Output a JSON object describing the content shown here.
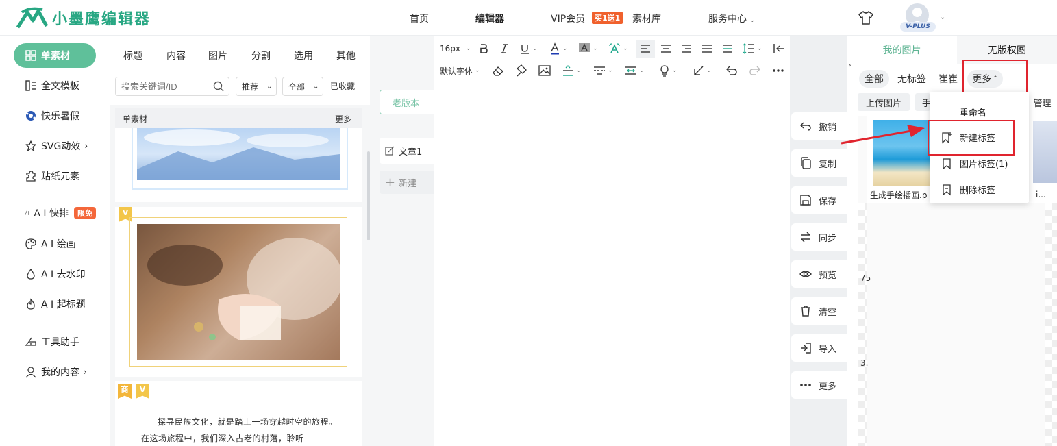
{
  "brand": {
    "name": "小墨鹰编辑器",
    "color": "#28a783"
  },
  "header": {
    "nav": {
      "home": "首页",
      "editor": "编辑器",
      "vip": "VIP会员",
      "vip_badge": "买1送1",
      "library": "素材库",
      "service": "服务中心"
    },
    "vip_plus": "V-PLUS"
  },
  "sidebar": {
    "items": [
      {
        "label": "单素材",
        "icon": "grid-icon",
        "active": true
      },
      {
        "label": "全文模板",
        "icon": "layout-icon"
      },
      {
        "label": "快乐暑假",
        "icon": "soccer-ball-icon"
      },
      {
        "label": "SVG动效",
        "icon": "star-icon",
        "has_arrow": true
      },
      {
        "label": "贴纸元素",
        "icon": "puzzle-icon"
      },
      {
        "label": "A I 快排",
        "icon": "ai-icon",
        "badge": "限免"
      },
      {
        "label": "A I 绘画",
        "icon": "palette-icon"
      },
      {
        "label": "A I 去水印",
        "icon": "drop-icon"
      },
      {
        "label": "A I 起标题",
        "icon": "flame-icon"
      },
      {
        "label": "工具助手",
        "icon": "tools-icon"
      },
      {
        "label": "我的内容",
        "icon": "user-icon",
        "has_arrow": true
      }
    ],
    "arrow": "›"
  },
  "materials": {
    "tabs": [
      "标题",
      "内容",
      "图片",
      "分割",
      "选用",
      "其他"
    ],
    "search_placeholder": "搜索关键词/ID",
    "filter_sort": "推荐",
    "filter_range": "全部",
    "favorites": "已收藏",
    "section_title": "单素材",
    "section_more": "更多",
    "badge_v": "V",
    "badge_shang": "商",
    "card_text": "探寻民族文化，就是踏上一场穿越时空的旅程。在这场旅程中，我们深入古老的村落，聆听"
  },
  "articles": {
    "old_version": "老版本",
    "current": "文章1",
    "new": "新建"
  },
  "toolbar": {
    "font_size": "16px",
    "font_family": "默认字体"
  },
  "actions": [
    {
      "label": "撤销",
      "icon": "undo-icon"
    },
    {
      "label": "复制",
      "icon": "copy-icon"
    },
    {
      "label": "保存",
      "icon": "save-icon"
    },
    {
      "label": "同步",
      "icon": "sync-icon"
    },
    {
      "label": "预览",
      "icon": "eye-icon"
    },
    {
      "label": "清空",
      "icon": "trash-icon"
    },
    {
      "label": "导入",
      "icon": "import-icon"
    },
    {
      "label": "更多",
      "icon": "more-dots-icon"
    }
  ],
  "images": {
    "tab_mine": "我的图片",
    "tab_free": "无版权图",
    "filters": {
      "all": "全部",
      "untagged": "无标签",
      "tag": "崔崔",
      "more": "更多"
    },
    "upload": "上传图片",
    "manage": "管理",
    "partial_btn": "手",
    "thumb_name": "生成手绘插画.p",
    "thumb_name_2": "_i...",
    "partial_label_1": "75",
    "partial_label_2": "3.",
    "menu": {
      "rename": "重命名",
      "new_tag": "新建标签",
      "image_tags": "图片标签(1)",
      "delete_tag": "删除标签"
    }
  },
  "colors": {
    "accent": "#5fc09a",
    "highlight": "#e0242e",
    "vip": "#f0612d"
  }
}
